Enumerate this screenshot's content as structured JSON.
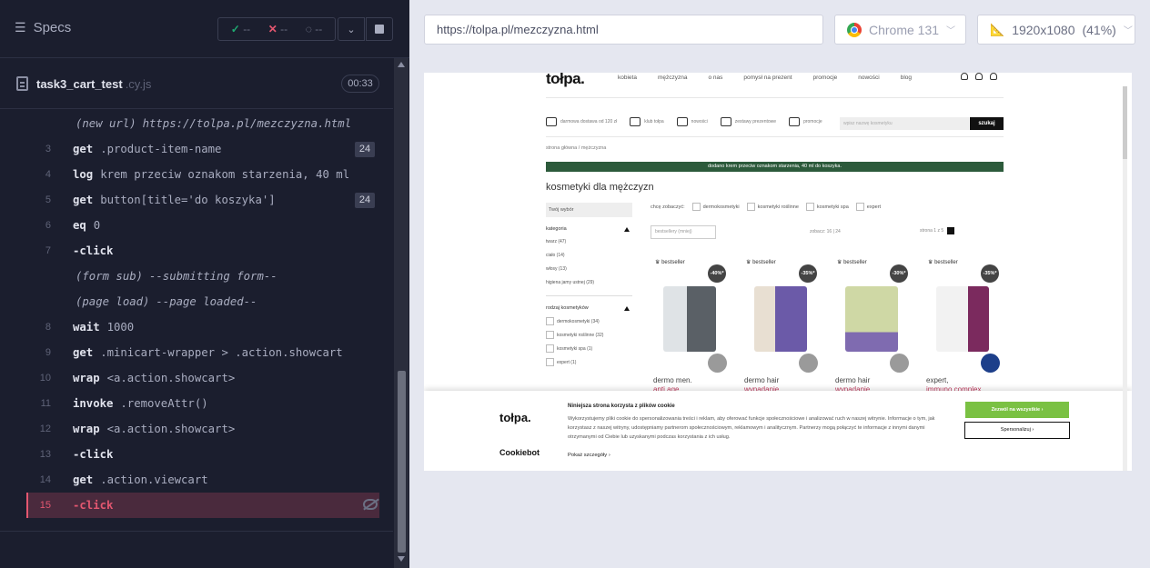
{
  "runner": {
    "specs_label": "Specs",
    "stats": {
      "passed": "--",
      "failed": "--",
      "pending": "--"
    },
    "file": {
      "name": "task3_cart_test",
      "ext": ".cy.js",
      "duration": "00:33"
    }
  },
  "commands": [
    {
      "num": "",
      "name": "(new url)",
      "msg": "https://tolpa.pl/mezczyzna.html",
      "badge": "",
      "type": "sys"
    },
    {
      "num": "3",
      "name": "get",
      "msg": ".product-item-name",
      "badge": "24",
      "type": "cmd"
    },
    {
      "num": "4",
      "name": "log",
      "msg": "krem przeciw oznakom starzenia, 40 ml",
      "badge": "",
      "type": "cmd"
    },
    {
      "num": "5",
      "name": "get",
      "msg": "button[title='do koszyka']",
      "badge": "24",
      "type": "cmd"
    },
    {
      "num": "6",
      "name": "eq",
      "msg": "0",
      "badge": "",
      "type": "cmd"
    },
    {
      "num": "7",
      "name": "-click",
      "msg": "",
      "badge": "",
      "type": "cmd"
    },
    {
      "num": "",
      "name": "(form sub)",
      "msg": "--submitting form--",
      "badge": "",
      "type": "sys"
    },
    {
      "num": "",
      "name": "(page load)",
      "msg": "--page loaded--",
      "badge": "",
      "type": "sys"
    },
    {
      "num": "8",
      "name": "wait",
      "msg": "1000",
      "badge": "",
      "type": "cmd"
    },
    {
      "num": "9",
      "name": "get",
      "msg": ".minicart-wrapper > .action.showcart",
      "badge": "",
      "type": "cmd"
    },
    {
      "num": "10",
      "name": "wrap",
      "msg": "<a.action.showcart>",
      "badge": "",
      "type": "cmd"
    },
    {
      "num": "11",
      "name": "invoke",
      "msg": ".removeAttr()",
      "badge": "",
      "type": "cmd"
    },
    {
      "num": "12",
      "name": "wrap",
      "msg": "<a.action.showcart>",
      "badge": "",
      "type": "cmd"
    },
    {
      "num": "13",
      "name": "-click",
      "msg": "",
      "badge": "",
      "type": "cmd"
    },
    {
      "num": "14",
      "name": "get",
      "msg": ".action.viewcart",
      "badge": "",
      "type": "cmd"
    },
    {
      "num": "15",
      "name": "-click",
      "msg": "",
      "badge": "",
      "type": "active"
    }
  ],
  "browser": {
    "url": "https://tolpa.pl/mezczyzna.html",
    "name": "Chrome 131",
    "viewport": "1920x1080",
    "scale": "(41%)"
  },
  "site": {
    "logo": "tołpa.",
    "nav": [
      "kobieta",
      "mężczyzna",
      "o nas",
      "pomysł na prezent",
      "promocje",
      "nowości",
      "blog"
    ],
    "features": [
      "darmowa dostawa od 120 zł",
      "klub tołpa",
      "nowości",
      "zestawy prezentowe",
      "promocje"
    ],
    "search_placeholder": "wpisz nazwę kosmetyku",
    "search_button": "szukaj",
    "breadcrumb": "strona główna / mężczyzna",
    "banner": "dodano krem przeciw oznakom starzenia, 40 ml do koszyka.",
    "title": "kosmetyki dla mężczyzn",
    "sidebar": {
      "your_choice": "Twój wybór",
      "category_heading": "kategoria",
      "categories": [
        "twarz (47)",
        "ciało (14)",
        "włosy (13)",
        "higiena jamy ustnej (29)"
      ],
      "type_heading": "rodzaj kosmetyków",
      "types": [
        "dermokosmetyki (34)",
        "kosmetyki roślinne (32)",
        "kosmetyki spa (1)",
        "expert (1)"
      ]
    },
    "choose_label": "chcę zobaczyć:",
    "choose_options": [
      "dermokosmetyki",
      "kosmetyki roślinne",
      "kosmetyki spa",
      "expert"
    ],
    "sort": "bestsellery (mniej)",
    "showing": "zobacz: 16 | 24",
    "pager": "strona 1 z 5",
    "products": [
      {
        "badge": "bestseller",
        "disc": "-40%*",
        "name1": "dermo men.",
        "name2": "anti age"
      },
      {
        "badge": "bestseller",
        "disc": "-35%*",
        "name1": "dermo hair",
        "name2": "wypadanie"
      },
      {
        "badge": "bestseller",
        "disc": "-30%*",
        "name1": "dermo hair",
        "name2": "wypadanie"
      },
      {
        "badge": "bestseller",
        "disc": "-35%*",
        "name1": "expert,",
        "name2": "immuno complex."
      }
    ],
    "cookie": {
      "logo": "tołpa.",
      "cookiebot": "Cookiebot",
      "title": "Niniejsza strona korzysta z plików cookie",
      "text": "Wykorzystujemy pliki cookie do spersonalizowania treści i reklam, aby oferować funkcje społecznościowe i analizować ruch w naszej witrynie. Informacje o tym, jak korzystasz z naszej witryny, udostępniamy partnerom społecznościowym, reklamowym i analitycznym. Partnerzy mogą połączyć te informacje z innymi danymi otrzymanymi od Ciebie lub uzyskanymi podczas korzystania z ich usług.",
      "more": "Pokaż szczegóły",
      "accept": "Zezwól na wszystkie",
      "customize": "Spersonalizuj"
    }
  }
}
